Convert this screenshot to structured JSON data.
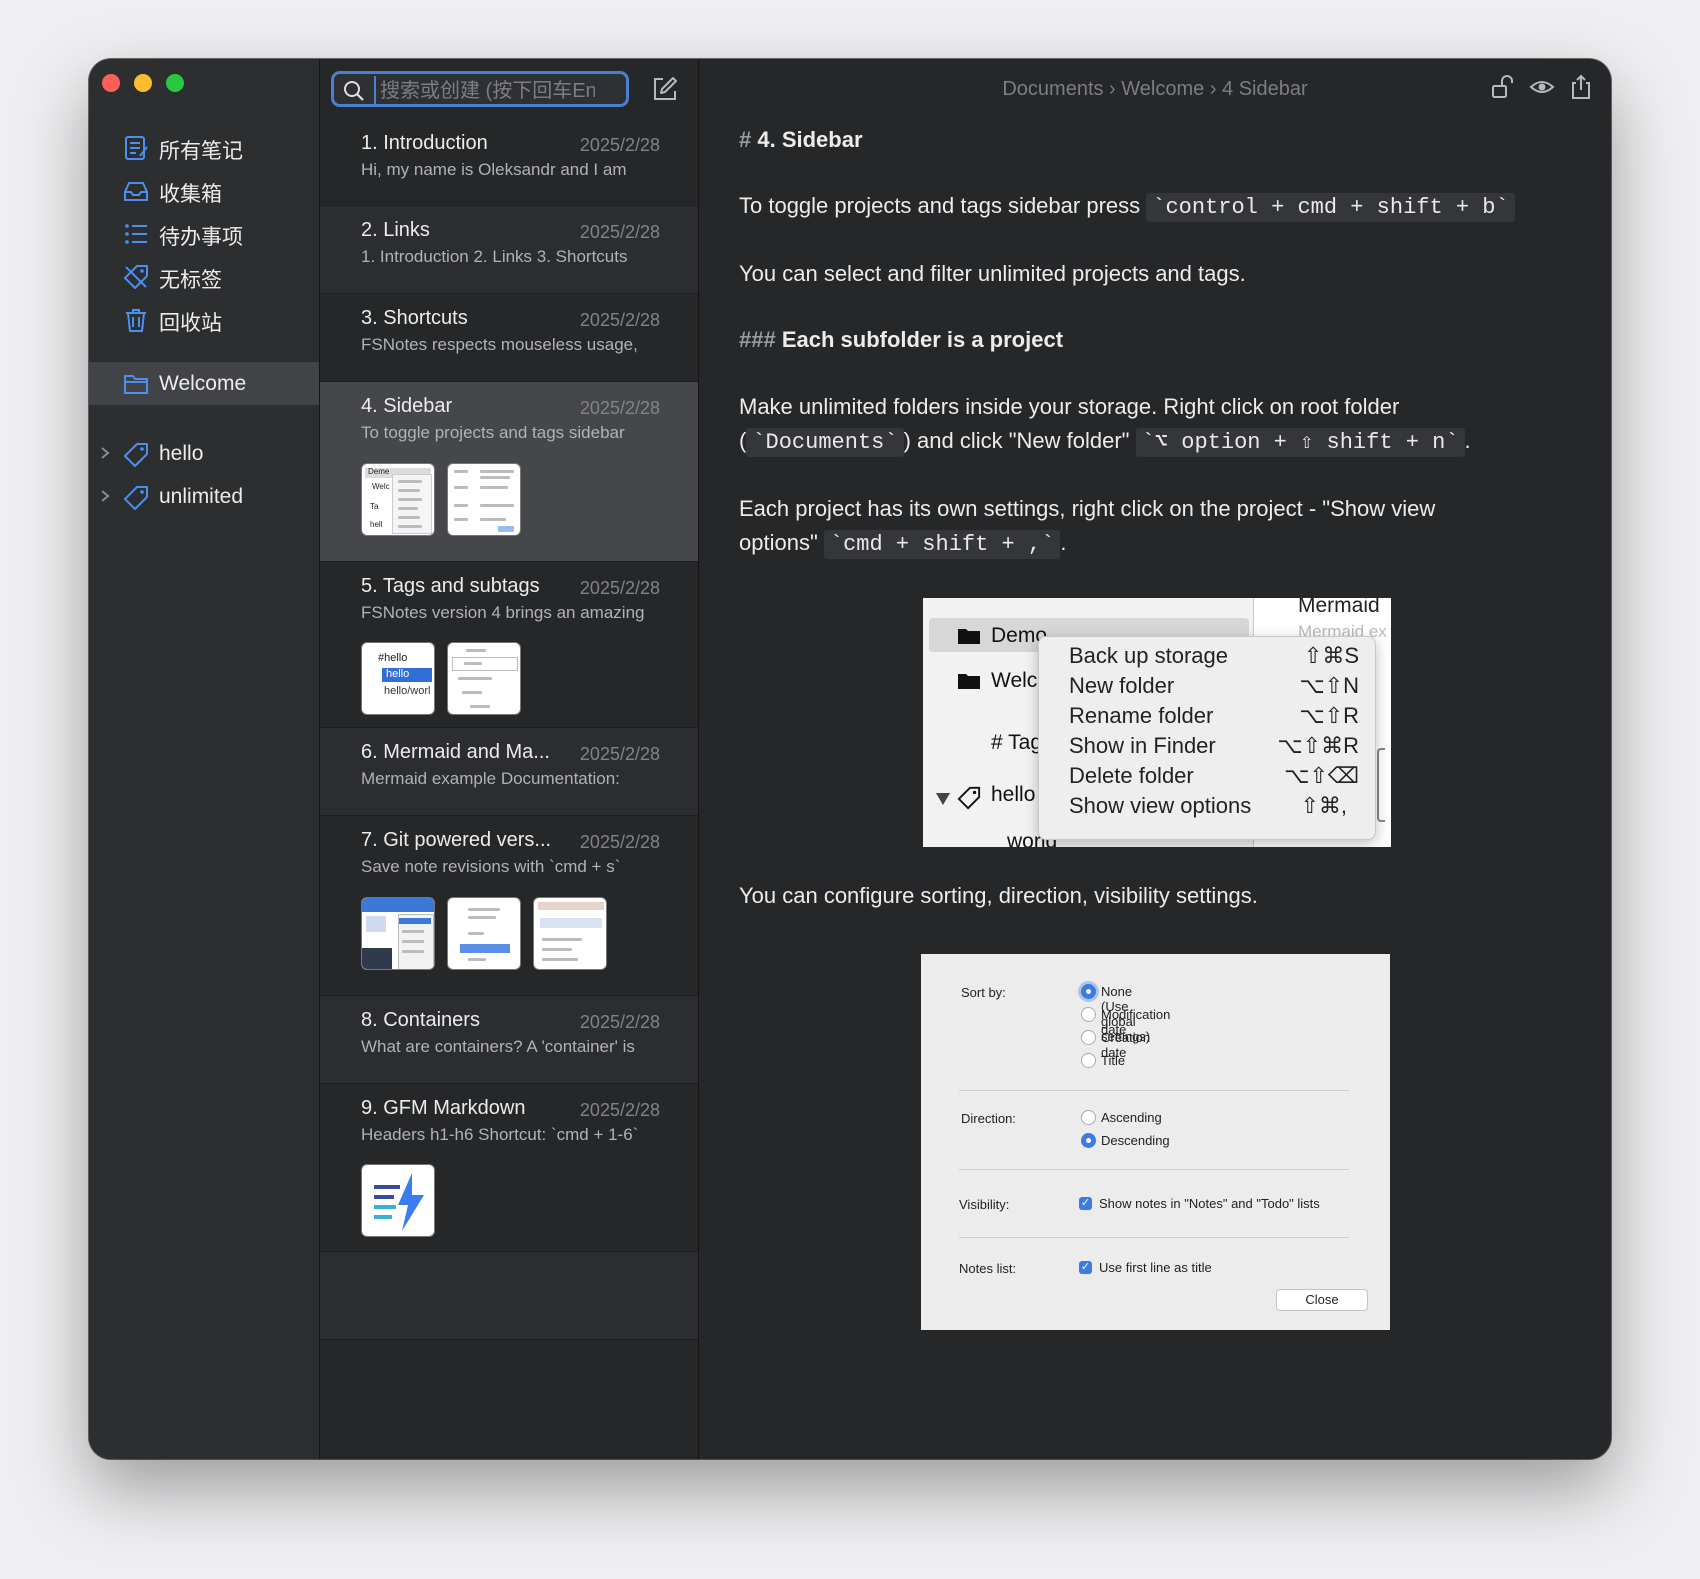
{
  "sidebar": {
    "items": [
      {
        "label": "所有笔记",
        "icon": "all-notes-icon"
      },
      {
        "label": "收集箱",
        "icon": "inbox-icon"
      },
      {
        "label": "待办事项",
        "icon": "todo-list-icon"
      },
      {
        "label": "无标签",
        "icon": "untagged-icon"
      },
      {
        "label": "回收站",
        "icon": "trash-icon"
      }
    ],
    "project": "Welcome",
    "tags": [
      "hello",
      "unlimited"
    ]
  },
  "search": {
    "placeholder": "搜索或创建 (按下回车Enter)"
  },
  "notes": [
    {
      "title": "1. Introduction",
      "date": "2025/2/28",
      "preview": "Hi, my name is Oleksandr and I am"
    },
    {
      "title": "2. Links",
      "date": "2025/2/28",
      "preview": "1. Introduction 2. Links 3. Shortcuts"
    },
    {
      "title": "3. Shortcuts",
      "date": "2025/2/28",
      "preview": "FSNotes respects mouseless usage,"
    },
    {
      "title": "4. Sidebar",
      "date": "2025/2/28",
      "preview": "To toggle projects and tags sidebar"
    },
    {
      "title": "5. Tags and subtags",
      "date": "2025/2/28",
      "preview": "FSNotes version 4 brings an amazing"
    },
    {
      "title": "6. Mermaid and Ma...",
      "date": "2025/2/28",
      "preview": "Mermaid example Documentation:"
    },
    {
      "title": "7. Git powered vers...",
      "date": "2025/2/28",
      "preview": "Save note revisions with `cmd + s`"
    },
    {
      "title": "8. Containers",
      "date": "2025/2/28",
      "preview": "What are containers? A 'container' is"
    },
    {
      "title": "9. GFM Markdown",
      "date": "2025/2/28",
      "preview": "Headers h1-h6 Shortcut: `cmd + 1-6`"
    }
  ],
  "thumb_text": {
    "t5a_1": "#hello",
    "t5a_2": "hello",
    "t5a_3": "hello/worl",
    "t4a": "Deme",
    "t4b": "Welc",
    "t4c": "Ta",
    "t4d": "hell"
  },
  "breadcrumb": "Documents › Welcome › 4 Sidebar",
  "doc": {
    "h1_hash": "#",
    "h1": "4. Sidebar",
    "p1_text": "To toggle projects and tags sidebar press",
    "p1_code": "`control + cmd + shift + b`",
    "p2": "You can select and filter unlimited projects and tags.",
    "h3_hash": "###",
    "h3": "Each subfolder is a project",
    "p3_line1": "Make unlimited folders inside your storage. Right click on root folder",
    "p3_pre": "(",
    "p3_code1": "`Documents`",
    "p3_mid": ") and click \"New folder\"",
    "p3_code2": "`⌥ option + ⇧ shift + n`",
    "p3_end": ".",
    "p4_line1": "Each project has its own settings, right click on the project - \"Show view",
    "p4_pre": "options\"",
    "p4_code": "`cmd + shift + ,`",
    "p4_end": ".",
    "p5": "You can configure sorting, direction, visibility settings."
  },
  "context_menu": {
    "sidebar_items": [
      "Demo",
      "Welc",
      "# Tag",
      "hello",
      "world"
    ],
    "top_right": "Mermaid",
    "top_right_sub": "Mermaid ex",
    "items": [
      {
        "label": "Back up storage",
        "shortcut": "⇧⌘S"
      },
      {
        "label": "New folder",
        "shortcut": "⌥⇧N"
      },
      {
        "label": "Rename folder",
        "shortcut": "⌥⇧R"
      },
      {
        "label": "Show in Finder",
        "shortcut": "⌥⇧⌘R"
      },
      {
        "label": "Delete folder",
        "shortcut": "⌥⇧⌫"
      },
      {
        "label": "Show view options",
        "shortcut": "⇧⌘,"
      }
    ]
  },
  "view_options": {
    "sort_label": "Sort by:",
    "sort_options": [
      "None (Use global settings)",
      "Modification date",
      "Creation date",
      "Title"
    ],
    "sort_selected": 0,
    "direction_label": "Direction:",
    "direction_options": [
      "Ascending",
      "Descending"
    ],
    "direction_selected": 1,
    "visibility_label": "Visibility:",
    "visibility_option": "Show notes in \"Notes\" and \"Todo\" lists",
    "noteslist_label": "Notes list:",
    "noteslist_option": "Use first line as title",
    "close": "Close"
  },
  "colors": {
    "accent": "#4a7fd1",
    "icon_blue": "#4b8ff0"
  }
}
